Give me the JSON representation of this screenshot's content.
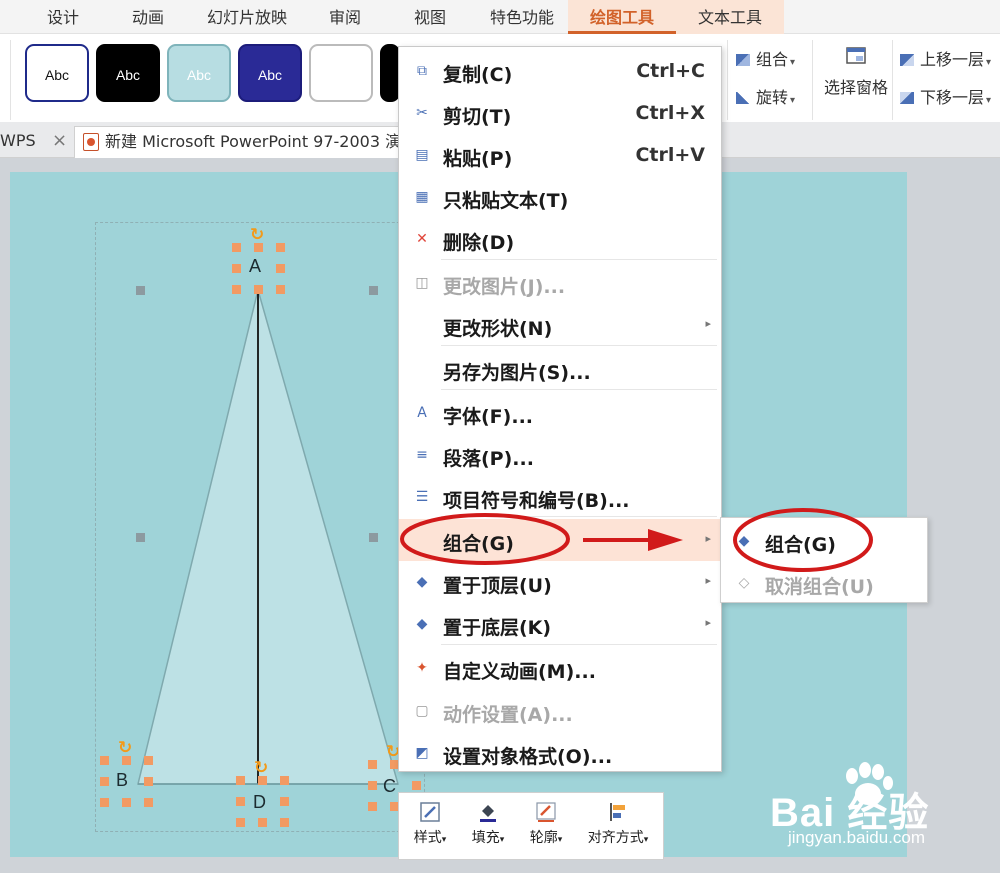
{
  "ribbon_tabs": [
    "设计",
    "动画",
    "幻灯片放映",
    "审阅",
    "视图",
    "特色功能",
    "绘图工具",
    "文本工具"
  ],
  "active_tab": "绘图工具",
  "style_gallery": [
    {
      "label": "Abc",
      "fill": "#ffffff",
      "border": "#1f2a8a",
      "text": "#111111"
    },
    {
      "label": "Abc",
      "fill": "#000000",
      "border": "#000000",
      "text": "#ffffff"
    },
    {
      "label": "Abc",
      "fill": "#b7dde2",
      "border": "#7fb4bb",
      "text": "#ffffff"
    },
    {
      "label": "Abc",
      "fill": "#2a2a96",
      "border": "#1c1c7a",
      "text": "#ffffff"
    },
    {
      "label": "",
      "fill": "#ffffff",
      "border": "#bbbbbb",
      "text": "#111111"
    },
    {
      "label": "",
      "fill": "#000000",
      "border": "#000000",
      "text": "#ffffff"
    }
  ],
  "ribbon_right": {
    "group": "组合",
    "rotate": "旋转",
    "selection_pane": "选择窗格",
    "bring_forward": "上移一层",
    "send_backward": "下移一层"
  },
  "doc_tabs": {
    "home": "WPS",
    "close_glyph": "×",
    "document": "新建 Microsoft PowerPoint 97-2003 演"
  },
  "slide_points": [
    "A",
    "B",
    "C",
    "D"
  ],
  "context_menu": [
    {
      "label": "复制(C)",
      "shortcut": "Ctrl+C",
      "icon": "copy-icon",
      "glyph": "⧉",
      "glyph_color": "#4a6fb5"
    },
    {
      "label": "剪切(T)",
      "shortcut": "Ctrl+X",
      "icon": "scissors-icon",
      "glyph": "✂",
      "glyph_color": "#4a6fb5"
    },
    {
      "label": "粘贴(P)",
      "shortcut": "Ctrl+V",
      "icon": "paste-icon",
      "glyph": "▤",
      "glyph_color": "#4a6fb5"
    },
    {
      "label": "只粘贴文本(T)",
      "icon": "paste-text-icon",
      "glyph": "▦",
      "glyph_color": "#4a6fb5"
    },
    {
      "label": "删除(D)",
      "icon": "delete-icon",
      "glyph": "✕",
      "glyph_color": "#e0453a"
    },
    {
      "label": "更改图片(J)...",
      "icon": "change-picture-icon",
      "glyph": "◫",
      "glyph_color": "#9a9a9a",
      "disabled": true
    },
    {
      "label": "更改形状(N)",
      "submenu": true
    },
    {
      "label": "另存为图片(S)..."
    },
    {
      "label": "字体(F)...",
      "icon": "font-icon",
      "glyph": "A",
      "glyph_color": "#4a6fb5"
    },
    {
      "label": "段落(P)...",
      "icon": "paragraph-icon",
      "glyph": "≡",
      "glyph_color": "#4a6fb5"
    },
    {
      "label": "项目符号和编号(B)...",
      "icon": "bullets-icon",
      "glyph": "☰",
      "glyph_color": "#4a6fb5"
    },
    {
      "label": "组合(G)",
      "submenu": true,
      "highlight": true
    },
    {
      "label": "置于顶层(U)",
      "icon": "bring-to-front-icon",
      "glyph": "◆",
      "glyph_color": "#4a6fb5",
      "submenu": true
    },
    {
      "label": "置于底层(K)",
      "icon": "send-to-back-icon",
      "glyph": "◆",
      "glyph_color": "#4a6fb5",
      "submenu": true
    },
    {
      "label": "自定义动画(M)...",
      "icon": "custom-animation-icon",
      "glyph": "✦",
      "glyph_color": "#d9552f"
    },
    {
      "label": "动作设置(A)...",
      "icon": "action-settings-icon",
      "glyph": "▢",
      "glyph_color": "#9a9a9a",
      "disabled": true
    },
    {
      "label": "设置对象格式(O)...",
      "icon": "format-object-icon",
      "glyph": "◩",
      "glyph_color": "#4a6fb5"
    }
  ],
  "submenu": [
    {
      "label": "组合(G)",
      "icon": "group-icon",
      "glyph": "◆",
      "glyph_color": "#4a6fb5"
    },
    {
      "label": "取消组合(U)",
      "icon": "ungroup-icon",
      "glyph": "◇",
      "glyph_color": "#a8a8a8",
      "disabled": true
    }
  ],
  "mini_toolbar": [
    "样式",
    "填充",
    "轮廓",
    "对齐方式"
  ],
  "watermark": {
    "brand": "Bai  经验",
    "url": "jingyan.baidu.com"
  },
  "annotation_color": "#d11a1a"
}
